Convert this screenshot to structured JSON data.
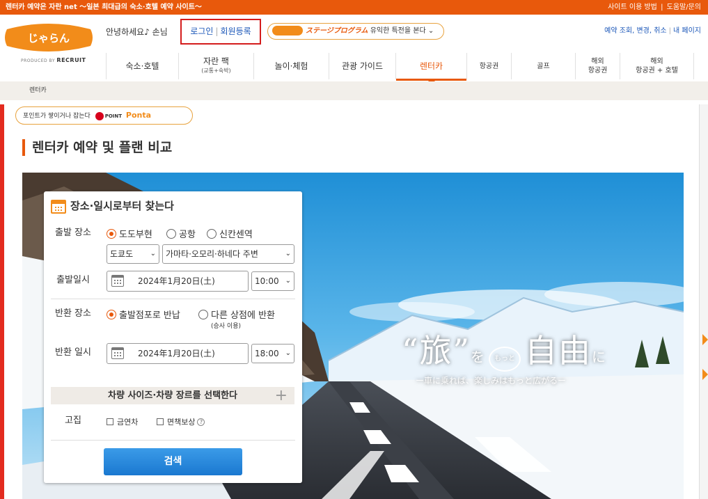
{
  "topbar": {
    "tagline": "렌터카 예약은 자란 net ～일본 최대급의 숙소·호텔 예약 사이트～",
    "links": [
      "사이트 이용 방법",
      "도움말/문의"
    ],
    "link_sep": "|"
  },
  "header": {
    "greeting": "안녕하세요♪ 손님",
    "login": "로그인",
    "register": "회원등록",
    "sep": "|",
    "stage_program": "ステージプログラム",
    "stage_desc": "유익한 특전을 본다",
    "account_links": "예약 조회, 변경, 취소",
    "mypage": "내 페이지",
    "produced_by": "PRODUCED BY",
    "recruit": "RECRUIT",
    "logo_text": "じゃらん"
  },
  "nav": {
    "items": [
      {
        "label": "숙소·호텔",
        "sub": ""
      },
      {
        "label": "자란 팩",
        "sub": "(교통+숙박)"
      },
      {
        "label": "놀이·체험",
        "sub": ""
      },
      {
        "label": "관광 가이드",
        "sub": ""
      },
      {
        "label": "렌터카",
        "sub": ""
      },
      {
        "label": "항공권",
        "sub": ""
      },
      {
        "label": "골프",
        "sub": ""
      },
      {
        "label": "해외",
        "sub": "항공권"
      },
      {
        "label": "해외",
        "sub": "항공권 + 호텔"
      }
    ]
  },
  "breadcrumb": "렌터카",
  "points": {
    "text": "포인트가 쌓이거나 잡는다",
    "dpoint": "POINT",
    "ponta": "Ponta"
  },
  "page_title": "렌터카 예약 및 플랜 비교",
  "hero": {
    "slogan_a": "“旅”",
    "slogan_b": "を",
    "slogan_c": "もっと",
    "slogan_d": "自由",
    "slogan_e": "に",
    "sub": "ー車に乗れば、楽しみはもっと広がるー"
  },
  "search": {
    "title": "장소·일시로부터 찾는다",
    "depart_place_label": "출발 장소",
    "radio_pref": "도도부현",
    "radio_airport": "공항",
    "radio_shinkansen": "신칸센역",
    "pref_value": "도쿄도",
    "area_value": "가마타·오모리·하네다 주변",
    "depart_date_label": "출발일시",
    "depart_date": "2024年1月20日(土)",
    "depart_time": "10:00",
    "return_place_label": "반환 장소",
    "radio_same": "출발점포로 반납",
    "radio_other": "다른 상점에 반환",
    "radio_other_note": "(승사 이용)",
    "return_date_label": "반환 일시",
    "return_date": "2024年1月20日(土)",
    "return_time": "18:00",
    "size_bar": "차량 사이즈·차량 장르를 선택한다",
    "cond_label": "고집",
    "nosmoke": "금연차",
    "insurance": "면책보상",
    "search_btn": "검색"
  }
}
